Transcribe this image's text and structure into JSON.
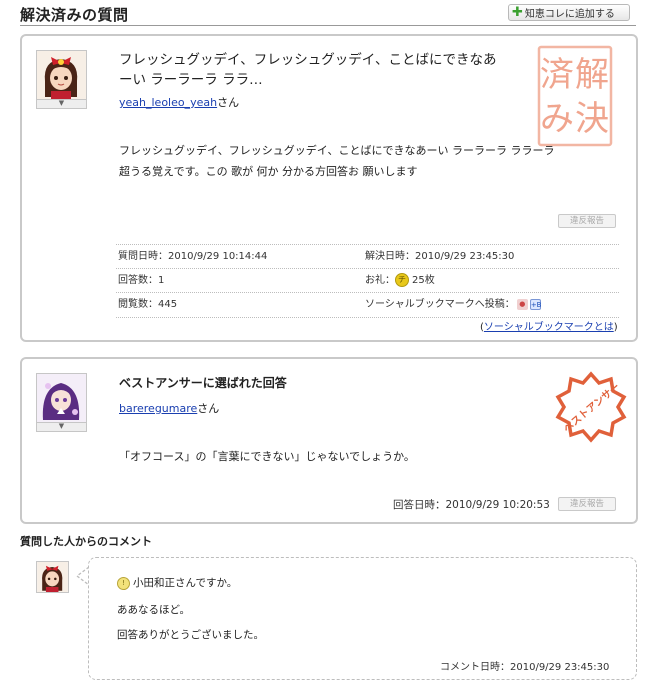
{
  "header": {
    "section_title": "解決済みの質問",
    "add_button_label": "知恵コレに追加する"
  },
  "question": {
    "title": "フレッシュグッデイ、フレッシュグッデイ、ことばにできなあーい ラーラーラ ララ…",
    "user": "yeah_leoleo_yeah",
    "user_suffix": "さん",
    "body_lines": [
      "フレッシュグッデイ、フレッシュグッデイ、ことばにできなあーい ラーラーラ ララーラ",
      "超うる覚えです。この 歌が 何か 分かる方回答お 願いします"
    ],
    "report_label": "違反報告",
    "stamp_text": [
      "解",
      "決",
      "済",
      "み"
    ],
    "meta": {
      "asked_at": "質問日時：2010/9/29 10:14:44",
      "resolved_at": "解決日時：2010/9/29 23:45:30",
      "answer_count": "回答数：1",
      "reward_label": "お礼：",
      "reward_icon": "チ",
      "reward_value": "25枚",
      "views": "閲覧数：445",
      "sbm_label": "ソーシャルブックマークへ投稿：",
      "sbm_icon2": "+B",
      "sbm_link_open": "(",
      "sbm_link": "ソーシャルブックマークとは",
      "sbm_link_close": ")"
    }
  },
  "best_answer": {
    "title": "ベストアンサーに選ばれた回答",
    "user": "bareregumare",
    "user_suffix": "さん",
    "body": "「オフコース」の「言葉にできない」じゃないでしょうか。",
    "answered_at": "回答日時：2010/9/29 10:20:53",
    "report_label": "違反報告",
    "stamp_text": "ベストアンサー"
  },
  "comment": {
    "heading": "質問した人からのコメント",
    "lines": [
      "小田和正さんですか。",
      "ああなるほど。",
      "回答ありがとうございました。"
    ],
    "commented_at": "コメント日時：2010/9/29 23:45:30"
  },
  "colors": {
    "link": "#1a3fb0",
    "stamp_red": "#e0603a",
    "border": "#c9c9c9"
  }
}
